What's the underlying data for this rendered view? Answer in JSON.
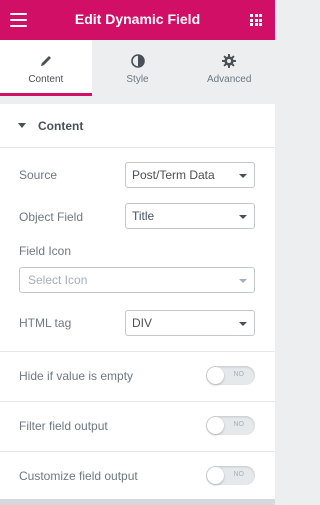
{
  "header": {
    "title": "Edit Dynamic Field"
  },
  "tabs": [
    {
      "label": "Content",
      "icon": "pencil-icon",
      "active": true
    },
    {
      "label": "Style",
      "icon": "contrast-icon",
      "active": false
    },
    {
      "label": "Advanced",
      "icon": "gear-icon",
      "active": false
    }
  ],
  "section": {
    "title": "Content"
  },
  "fields": {
    "source": {
      "label": "Source",
      "value": "Post/Term Data"
    },
    "object_field": {
      "label": "Object Field",
      "value": "Title"
    },
    "field_icon": {
      "label": "Field Icon",
      "placeholder": "Select Icon"
    },
    "html_tag": {
      "label": "HTML tag",
      "value": "DIV"
    }
  },
  "toggles": [
    {
      "label": "Hide if value is empty",
      "state": "NO"
    },
    {
      "label": "Filter field output",
      "state": "NO"
    },
    {
      "label": "Customize field output",
      "state": "NO"
    }
  ],
  "colors": {
    "brand": "#d20f66",
    "text": "#6d7882",
    "heading": "#495157"
  }
}
